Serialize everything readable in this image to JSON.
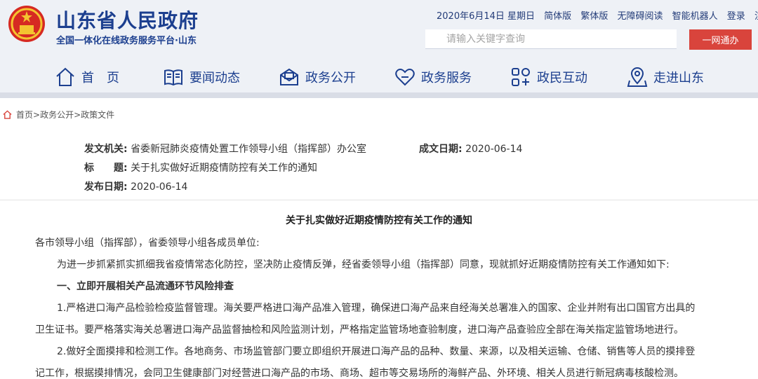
{
  "header": {
    "site_title": "山东省人民政府",
    "site_subtitle": "全国一体化在线政务服务平台·山东",
    "date": "2020年6月14日 星期日",
    "links": [
      "简体版",
      "繁体版",
      "无障碍阅读",
      "智能机器人",
      "登录",
      "注册"
    ],
    "search_placeholder": "请输入关键字查询",
    "search_button": "一网通办"
  },
  "nav": {
    "items": [
      {
        "label": "首　页",
        "icon": "home-icon"
      },
      {
        "label": "要闻动态",
        "icon": "news-icon"
      },
      {
        "label": "政务公开",
        "icon": "mail-icon"
      },
      {
        "label": "政务服务",
        "icon": "heart-icon"
      },
      {
        "label": "政民互动",
        "icon": "interaction-icon"
      },
      {
        "label": "走进山东",
        "icon": "map-pin-icon"
      }
    ]
  },
  "breadcrumb": {
    "items": [
      "首页",
      "政务公开",
      "政策文件"
    ],
    "separator": ">"
  },
  "meta": {
    "issuer_label": "发文机关:",
    "issuer": "省委新冠肺炎疫情处置工作领导小组（指挥部）办公室",
    "created_label": "成文日期:",
    "created": "2020-06-14",
    "title_label": "标　　题:",
    "title": "关于扎实做好近期疫情防控有关工作的通知",
    "published_label": "发布日期:",
    "published": "2020-06-14"
  },
  "article": {
    "title": "关于扎实做好近期疫情防控有关工作的通知",
    "p1": "各市领导小组（指挥部），省委领导小组各成员单位:",
    "p2": "为进一步抓紧抓实抓细我省疫情常态化防控，坚决防止疫情反弹，经省委领导小组（指挥部）同意，现就抓好近期疫情防控有关工作通知如下:",
    "h1": "一、立即开展相关产品流通环节风险排查",
    "p3a": "1.严格进口海产品检验检疫监督管理。海关要严格进口海产品准入管理，确保进口海产品来自经海关总署准入的国家、企业并附有出口国官方出具的",
    "p3b": "卫生证书。要严格落实海关总署进口海产品监督抽检和风险监测计划，严格指定监管场地查验制度，进口海产品查验应全部在海关指定监管场地进行。",
    "p4a": "2.做好全面摸排和检测工作。各地商务、市场监管部门要立即组织开展进口海产品的品种、数量、来源，以及相关运输、仓储、销售等人员的摸排登",
    "p4b": "记工作，根据摸排情况，会同卫生健康部门对经营进口海产品的市场、商场、超市等交易场所的海鲜产品、外环境、相关人员进行新冠病毒核酸检测。"
  },
  "colors": {
    "brand_blue": "#1c3f8f",
    "accent_red": "#d9443c",
    "header_bg": "#eef1f6"
  }
}
